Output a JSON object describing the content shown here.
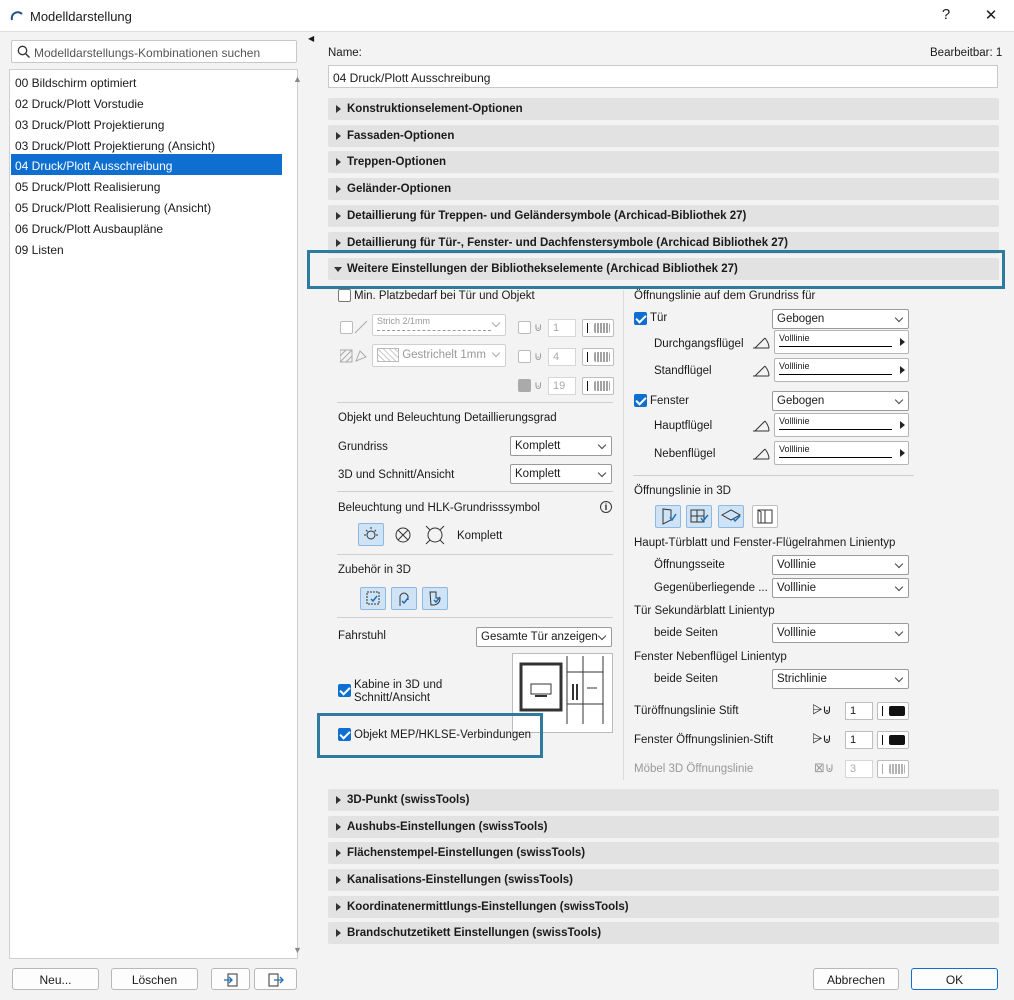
{
  "window": {
    "title": "Modelldarstellung",
    "help": "?",
    "close": "✕"
  },
  "search": {
    "placeholder": "Modelldarstellungs-Kombinationen suchen"
  },
  "combinations": [
    "00 Bildschirm optimiert",
    "02 Druck/Plott Vorstudie",
    "03 Druck/Plott Projektierung",
    "03 Druck/Plott Projektierung (Ansicht)",
    "04 Druck/Plott Ausschreibung",
    "05 Druck/Plott Realisierung",
    "05 Druck/Plott Realisierung (Ansicht)",
    "06 Druck/Plott Ausbaupläne",
    "09 Listen"
  ],
  "selected_index": 4,
  "left_buttons": {
    "new": "Neu...",
    "delete": "Löschen"
  },
  "name_label": "Name:",
  "editable_label": "Bearbeitbar: 1",
  "name_value": "04 Druck/Plott Ausschreibung",
  "sections_top": [
    "Konstruktionselement-Optionen",
    "Fassaden-Optionen",
    "Treppen-Optionen",
    "Geländer-Optionen",
    "Detaillierung für Treppen- und Geländersymbole (Archicad-Bibliothek 27)",
    "Detaillierung für Tür-, Fenster- und Dachfenstersymbole (Archicad Bibliothek 27)"
  ],
  "section_open": "Weitere Einstellungen der Bibliothekselemente (Archicad Bibliothek 27)",
  "sections_bottom": [
    "3D-Punkt (swissTools)",
    "Aushubs-Einstellungen (swissTools)",
    "Flächenstempel-Einstellungen (swissTools)",
    "Kanalisations-Einstellungen (swissTools)",
    "Koordinatenermittlungs-Einstellungen (swissTools)",
    "Brandschutzetikett Einstellungen (swissTools)"
  ],
  "left": {
    "min_space": "Min. Platzbedarf bei Tür und Objekt",
    "line_type": "Strich 2/1mm",
    "fill_type": "Gestrichelt 1mm",
    "pen1": "1",
    "pen2": "4",
    "pen3": "19",
    "detail_heading": "Objekt und Beleuchtung Detaillierungsgrad",
    "grundriss_label": "Grundriss",
    "grundriss_value": "Komplett",
    "schnitt_label": "3D und Schnitt/Ansicht",
    "schnitt_value": "Komplett",
    "light_heading": "Beleuchtung und HLK-Grundrisssymbol",
    "info": "i",
    "light_value": "Komplett",
    "zubehoer": "Zubehör in 3D",
    "fahrstuhl_label": "Fahrstuhl",
    "fahrstuhl_value": "Gesamte Tür anzeigen",
    "kabine": "Kabine in 3D und Schnitt/Ansicht",
    "mep": "Objekt MEP/HKLSE-Verbindungen"
  },
  "right": {
    "heading": "Öffnungslinie auf dem Grundriss für",
    "tuer": "Tür",
    "tuer_value": "Gebogen",
    "durchgang": "Durchgangsflügel",
    "stand": "Standflügel",
    "fenster": "Fenster",
    "fenster_value": "Gebogen",
    "haupt": "Hauptflügel",
    "neben": "Nebenflügel",
    "line_value": "Volllinie",
    "heading3d": "Öffnungslinie in 3D",
    "frame_heading": "Haupt-Türblatt und Fenster-Flügelrahmen Linientyp",
    "oeffnungsseite": "Öffnungsseite",
    "oeffnungsseite_value": "Volllinie",
    "gegen": "Gegenüberliegende ...",
    "gegen_value": "Volllinie",
    "sek_heading": "Tür Sekundärblatt Linientyp",
    "beide1": "beide Seiten",
    "beide1_value": "Volllinie",
    "neben_heading": "Fenster Nebenflügel Linientyp",
    "beide2": "beide Seiten",
    "beide2_value": "Strichlinie",
    "tuer_pen": "Türöffnungslinie Stift",
    "tuer_pen_value": "1",
    "fenster_pen": "Fenster Öffnungslinien-Stift",
    "fenster_pen_value": "1",
    "moebel": "Möbel 3D Öffnungslinie",
    "moebel_value": "3"
  },
  "footer": {
    "cancel": "Abbrechen",
    "ok": "OK"
  }
}
